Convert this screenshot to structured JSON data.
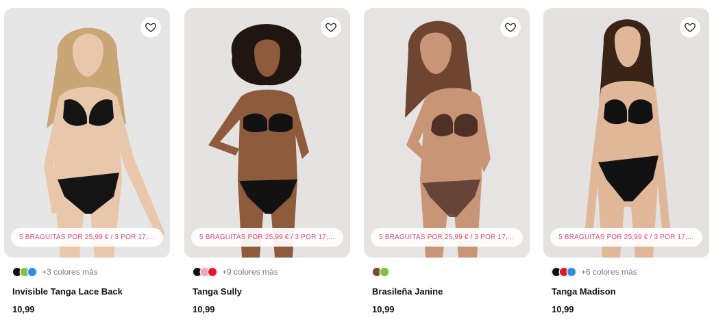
{
  "products": [
    {
      "name": "Invisible Tanga Lace Back",
      "price": "10,99",
      "promo": "5 BRAGUITAS POR 25,99 € / 3 POR 17,...",
      "more_colors": "+3 colores más",
      "swatches": [
        "#111111",
        "#7cc243",
        "#2f8be6"
      ],
      "bg": "#e7e6e6",
      "hair": "#caa576",
      "skin": "#e9c7ab",
      "lingerie": "#141414"
    },
    {
      "name": "Tanga Sully",
      "price": "10,99",
      "promo": "5 BRAGUITAS POR 25,99 € / 3 POR 17,...",
      "more_colors": "+9 colores más",
      "swatches": [
        "#111111",
        "#f3a3bf",
        "#e3192b"
      ],
      "bg": "#e5e3e2",
      "hair": "#1f1612",
      "skin": "#8f5b3d",
      "lingerie": "#121212"
    },
    {
      "name": "Brasileña Janine",
      "price": "10,99",
      "promo": "5 BRAGUITAS POR 25,99 € / 3 POR 17,...",
      "more_colors": "",
      "swatches": [
        "#7a4b35",
        "#7cc243"
      ],
      "bg": "#e6e4e2",
      "hair": "#6e4530",
      "skin": "#c99577",
      "lingerie": "#4e3027"
    },
    {
      "name": "Tanga Madison",
      "price": "10,99",
      "promo": "5 BRAGUITAS POR 25,99 € / 3 POR 17,...",
      "more_colors": "+6 colores más",
      "swatches": [
        "#111111",
        "#d9192b",
        "#2f8be6"
      ],
      "bg": "#e4e2e1",
      "hair": "#3a2418",
      "skin": "#e0b899",
      "lingerie": "#111111"
    }
  ],
  "icons": {
    "favorite": "heart-outline-icon"
  }
}
